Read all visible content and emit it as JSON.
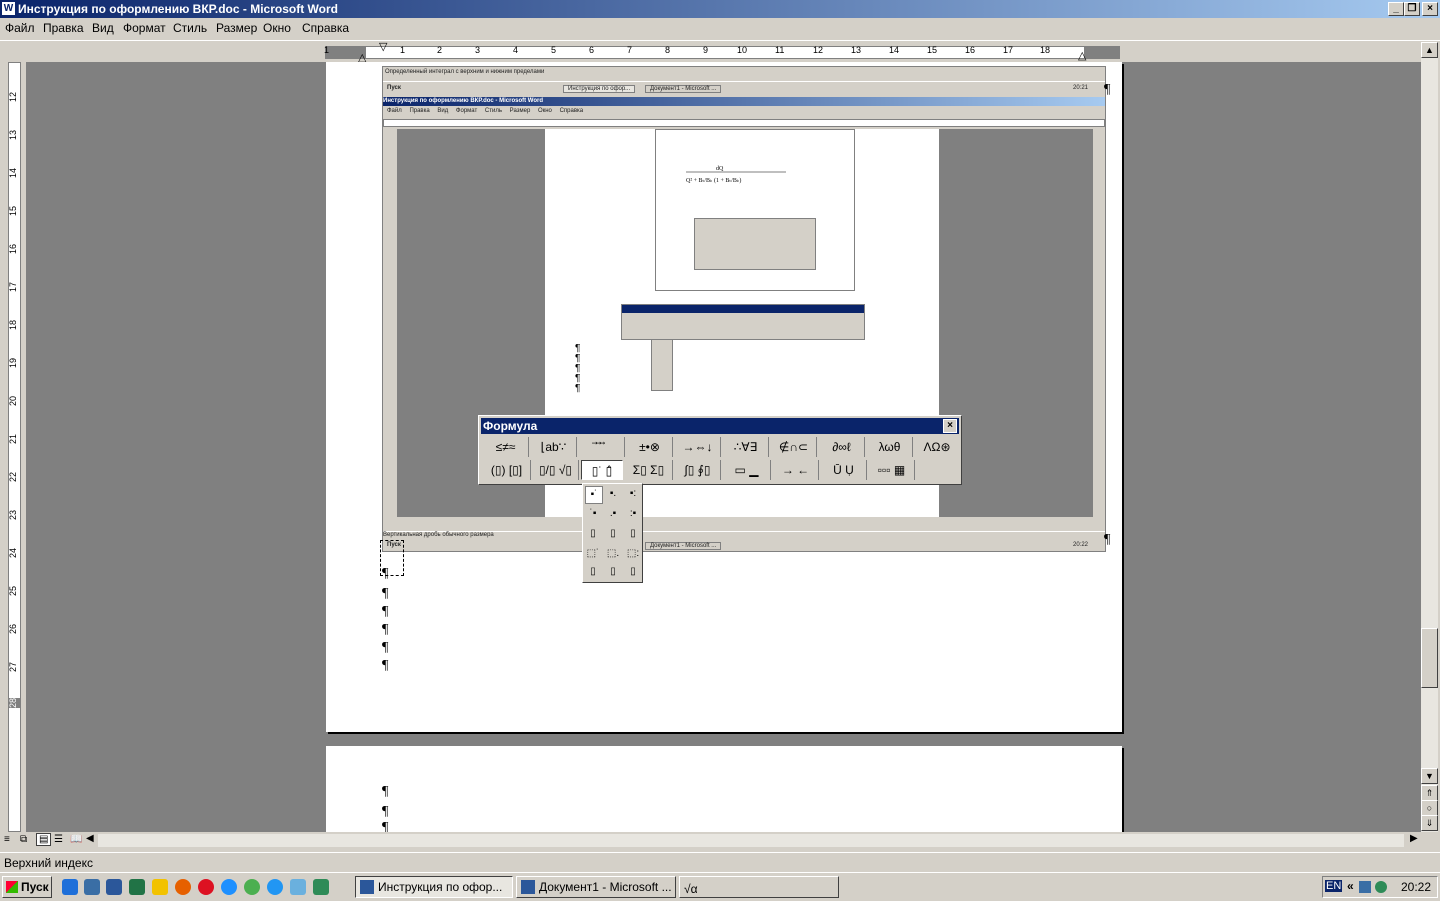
{
  "window": {
    "title": "Инструкция по оформлению ВКР.doc - Microsoft Word",
    "icon": "word-doc-icon"
  },
  "menu": [
    "Файл",
    "Правка",
    "Вид",
    "Формат",
    "Стиль",
    "Размер",
    "Окно",
    "Справка"
  ],
  "ruler": {
    "horizontal_ticks": [
      "1",
      "1",
      "2",
      "3",
      "4",
      "5",
      "6",
      "7",
      "8",
      "9",
      "10",
      "11",
      "12",
      "13",
      "14",
      "15",
      "16",
      "17",
      "18"
    ],
    "vertical_ticks": [
      "12",
      "13",
      "14",
      "15",
      "16",
      "17",
      "18",
      "19",
      "20",
      "21",
      "22",
      "23",
      "24",
      "25",
      "26",
      "27",
      "28"
    ]
  },
  "document": {
    "pilcrow": "¶",
    "caption_top": "Определенный интеграл с верхним и нижним пределами",
    "caption_bottom": "Вертикальная дробь обычного размера"
  },
  "embedded_screenshot": {
    "title": "Инструкция по оформлению ВКР.doc - Microsoft Word",
    "menu": [
      "Файл",
      "Правка",
      "Вид",
      "Формат",
      "Стиль",
      "Размер",
      "Окно",
      "Справка"
    ],
    "start_label": "Пуск",
    "task1": "Инструкция по офор...",
    "task2": "Документ1 - Microsoft ...",
    "time1": "20:21",
    "time2": "20:22"
  },
  "formula_toolbar": {
    "title": "Формула",
    "row1": [
      "≤≠≈",
      "⌊ab∵",
      "⃗ ⃗ ⃗",
      "±•⊗",
      "→⇔↓",
      "∴∀∃",
      "∉∩⊂",
      "∂∞ℓ",
      "λωθ",
      "ΛΩ⊛"
    ],
    "row2": [
      "(▯) [▯]",
      "▯/▯ √▯",
      "▯˙ ▯̂",
      "Σ▯ Σ▯",
      "∫▯ ∮▯",
      "▭ ▁",
      "→ ←",
      "Ū Ụ",
      "▫▫▫ ▦"
    ]
  },
  "status_bar": {
    "text": "Верхний индекс"
  },
  "taskbar": {
    "start": "Пуск",
    "tasks": [
      {
        "label": "Инструкция по офор...",
        "active": true
      },
      {
        "label": "Документ1 - Microsoft ...",
        "active": false
      },
      {
        "label": "",
        "active": false
      }
    ],
    "tray_lang": "EN",
    "tray_chevron": "«",
    "clock": "20:22"
  },
  "colors": {
    "titlebar_start": "#0a246a",
    "titlebar_end": "#a6caf0",
    "chrome": "#d4d0c8",
    "workspace": "#808080"
  }
}
